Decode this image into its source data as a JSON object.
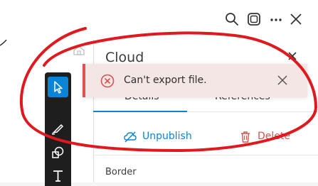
{
  "panel": {
    "title": "Cloud",
    "tabs": [
      {
        "label": "Details",
        "active": true
      },
      {
        "label": "References",
        "active": false
      }
    ],
    "actions": {
      "unpublish_label": "Unpublish",
      "delete_label": "Delete"
    },
    "section_border_label": "Border"
  },
  "toast": {
    "message": "Can't export file.",
    "type": "error"
  },
  "colors": {
    "accent": "#0a84d6",
    "error": "#d9534f",
    "annotation": "#e0191e"
  },
  "icons": [
    "search-icon",
    "sticker-icon",
    "more-icon",
    "close-icon",
    "select-icon",
    "pen-icon",
    "shapes-icon",
    "text-icon",
    "home-icon",
    "error-icon",
    "unpublish-icon",
    "trash-icon"
  ]
}
